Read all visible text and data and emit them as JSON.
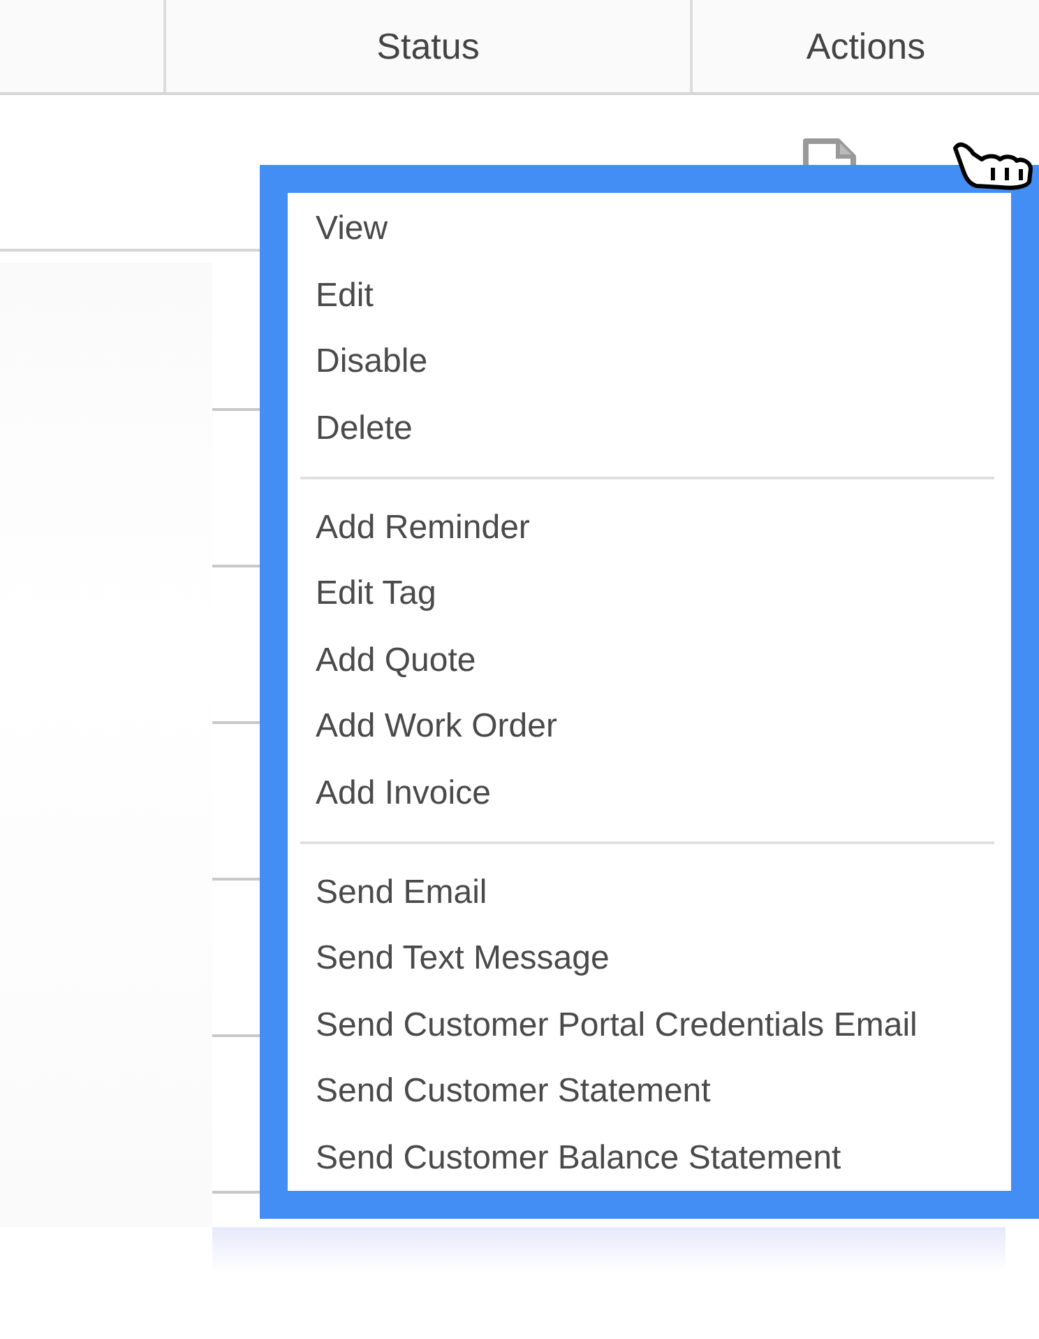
{
  "table": {
    "columns": [
      "Status",
      "Actions"
    ]
  },
  "menu": {
    "groups": [
      {
        "items": [
          {
            "label": "View"
          },
          {
            "label": "Edit"
          },
          {
            "label": "Disable"
          },
          {
            "label": "Delete"
          }
        ]
      },
      {
        "items": [
          {
            "label": "Add Reminder"
          },
          {
            "label": "Edit Tag"
          },
          {
            "label": "Add Quote"
          },
          {
            "label": "Add Work Order"
          },
          {
            "label": "Add Invoice"
          }
        ]
      },
      {
        "items": [
          {
            "label": "Send Email"
          },
          {
            "label": "Send Text Message"
          },
          {
            "label": "Send Customer Portal Credentials Email"
          },
          {
            "label": "Send Customer Statement"
          },
          {
            "label": "Send Customer Balance Statement"
          }
        ]
      }
    ]
  }
}
